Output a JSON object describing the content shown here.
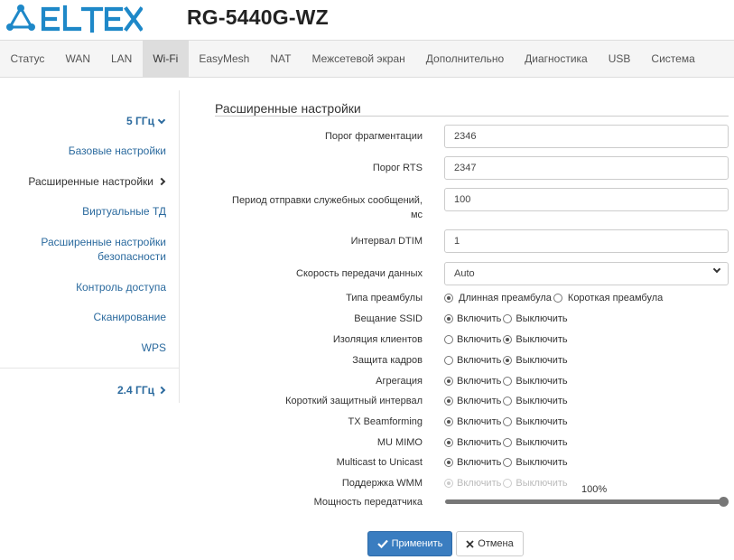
{
  "header": {
    "logo_text": "ELTEX",
    "model": "RG-5440G-WZ"
  },
  "nav": [
    "Статус",
    "WAN",
    "LAN",
    "Wi-Fi",
    "EasyMesh",
    "NAT",
    "Межсетевой экран",
    "Дополнительно",
    "Диагностика",
    "USB",
    "Система"
  ],
  "nav_active": "Wi-Fi",
  "sidebar": {
    "group_5": "5 ГГц",
    "items": [
      "Базовые настройки",
      "Расширенные настройки",
      "Виртуальные ТД",
      "Расширенные настройки безопасности",
      "Контроль доступа",
      "Сканирование",
      "WPS"
    ],
    "group_24": "2.4 ГГц"
  },
  "section": {
    "title": "Расширенные настройки"
  },
  "fields": {
    "frag": {
      "label": "Порог фрагментации",
      "value": "2346"
    },
    "rts": {
      "label": "Порог RTS",
      "value": "2347"
    },
    "beacon": {
      "label": "Период отправки служебных сообщений, мс",
      "value": "100"
    },
    "dtim": {
      "label": "Интервал DTIM",
      "value": "1"
    },
    "rate": {
      "label": "Скорость передачи данных",
      "value": "Auto"
    }
  },
  "preamble": {
    "label": "Типа преамбулы",
    "opt1": "Длинная преамбула",
    "opt2": "Короткая преамбула",
    "selected": 1
  },
  "toggles": [
    {
      "label": "Вещание SSID",
      "on": true
    },
    {
      "label": "Изоляция клиентов",
      "on": false
    },
    {
      "label": "Защита кадров",
      "on": false
    },
    {
      "label": "Агрегация",
      "on": true
    },
    {
      "label": "Короткий защитный интервал",
      "on": true
    },
    {
      "label": "TX Beamforming",
      "on": true
    },
    {
      "label": "MU MIMO",
      "on": true
    },
    {
      "label": "Multicast to Unicast",
      "on": true
    },
    {
      "label": "Поддержка WMM",
      "on": true,
      "disabled": true
    }
  ],
  "enable_text": "Включить",
  "disable_text": "Выключить",
  "power": {
    "label": "Мощность передатчика",
    "value_text": "100%",
    "value": 1.0
  },
  "buttons": {
    "apply": "Применить",
    "cancel": "Отмена"
  },
  "colors": {
    "link": "#2b6a9e",
    "primary": "#3a7dc0",
    "logo": "#1e88c8"
  }
}
